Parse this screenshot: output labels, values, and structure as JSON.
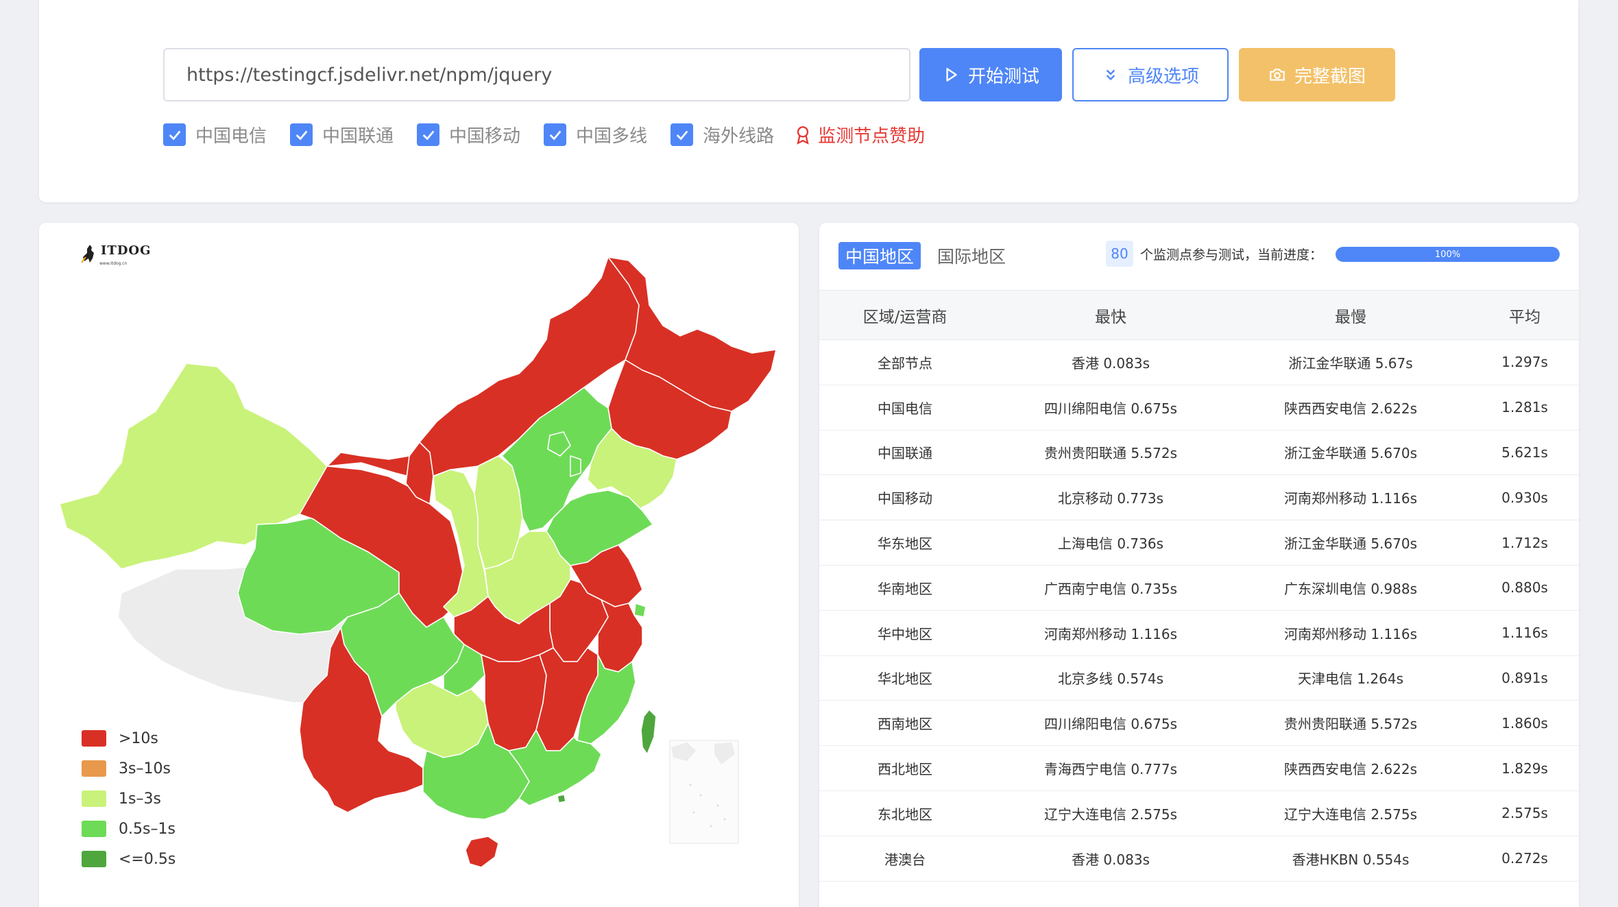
{
  "toolbar": {
    "url_value": "https://testingcf.jsdelivr.net/npm/jquery",
    "start_label": "开始测试",
    "advanced_label": "高级选项",
    "screenshot_label": "完整截图"
  },
  "filters": [
    {
      "label": "中国电信",
      "checked": true
    },
    {
      "label": "中国联通",
      "checked": true
    },
    {
      "label": "中国移动",
      "checked": true
    },
    {
      "label": "中国多线",
      "checked": true
    },
    {
      "label": "海外线路",
      "checked": true
    }
  ],
  "sponsor_label": "监测节点赞助",
  "map": {
    "logo_text": "ITDOG",
    "logo_sub": "www.itdog.cn",
    "legend": [
      {
        "label": ">10s",
        "color": "#d93025"
      },
      {
        "label": "3s–10s",
        "color": "#e8994b"
      },
      {
        "label": "1s–3s",
        "color": "#c9f27a"
      },
      {
        "label": "0.5s–1s",
        "color": "#6edb57"
      },
      {
        "label": "<=0.5s",
        "color": "#4fa63d"
      }
    ],
    "colors": {
      "red": "#d93025",
      "lightgreen": "#c9f27a",
      "green": "#6edb57",
      "darkgreen": "#4fa63d",
      "gray": "#ececec"
    }
  },
  "results": {
    "tabs": [
      "中国地区",
      "国际地区"
    ],
    "node_count": "80",
    "count_text": "个监测点参与测试，当前进度：",
    "progress": 100,
    "progress_label": "100%",
    "headers": [
      "区域/运营商",
      "最快",
      "最慢",
      "平均"
    ],
    "rows": [
      [
        "全部节点",
        "香港 0.083s",
        "浙江金华联通 5.67s",
        "1.297s"
      ],
      [
        "中国电信",
        "四川绵阳电信 0.675s",
        "陕西西安电信 2.622s",
        "1.281s"
      ],
      [
        "中国联通",
        "贵州贵阳联通 5.572s",
        "浙江金华联通 5.670s",
        "5.621s"
      ],
      [
        "中国移动",
        "北京移动 0.773s",
        "河南郑州移动 1.116s",
        "0.930s"
      ],
      [
        "华东地区",
        "上海电信 0.736s",
        "浙江金华联通 5.670s",
        "1.712s"
      ],
      [
        "华南地区",
        "广西南宁电信 0.735s",
        "广东深圳电信 0.988s",
        "0.880s"
      ],
      [
        "华中地区",
        "河南郑州移动 1.116s",
        "河南郑州移动 1.116s",
        "1.116s"
      ],
      [
        "华北地区",
        "北京多线 0.574s",
        "天津电信 1.264s",
        "0.891s"
      ],
      [
        "西南地区",
        "四川绵阳电信 0.675s",
        "贵州贵阳联通 5.572s",
        "1.860s"
      ],
      [
        "西北地区",
        "青海西宁电信 0.777s",
        "陕西西安电信 2.622s",
        "1.829s"
      ],
      [
        "东北地区",
        "辽宁大连电信 2.575s",
        "辽宁大连电信 2.575s",
        "2.575s"
      ],
      [
        "港澳台",
        "香港 0.083s",
        "香港HKBN 0.554s",
        "0.272s"
      ]
    ]
  }
}
